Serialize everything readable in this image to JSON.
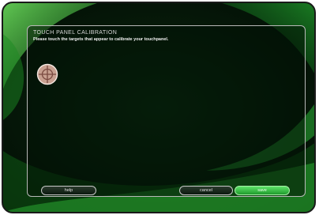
{
  "screen": {
    "title": "TOUCH PANEL CALIBRATION",
    "instruction": "Please touch the targets that appear to calibrate your touchpanel."
  },
  "target": {
    "icon": "crosshair-target-icon"
  },
  "buttons": {
    "help_label": "help",
    "cancel_label": "cancel",
    "save_label": "save"
  },
  "colors": {
    "background": "#041a08",
    "accent_green": "#3fbf4a",
    "target_fill": "#c8a090"
  }
}
